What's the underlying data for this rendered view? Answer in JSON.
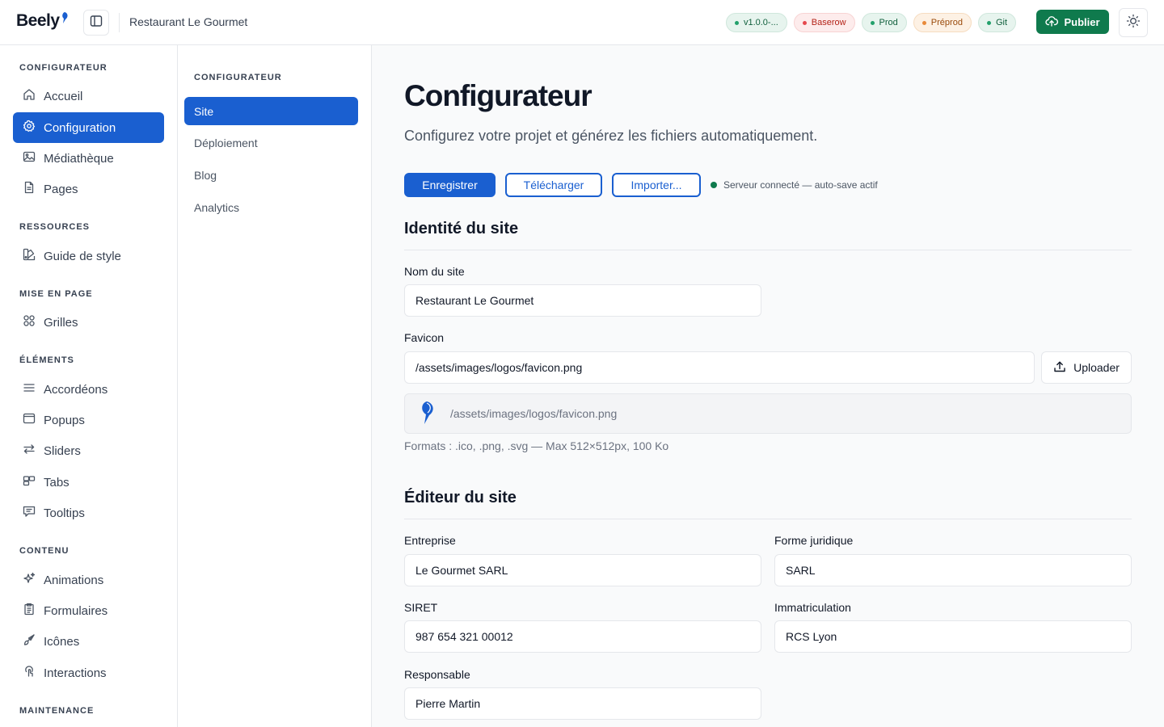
{
  "topbar": {
    "logo_text": "Beely",
    "project_name": "Restaurant Le Gourmet",
    "badges": [
      {
        "label": "v1.0.0-...",
        "bg": "#e7f4ee",
        "border": "#cfe7dc",
        "color": "#0f5f3c",
        "dot": "#22a06b"
      },
      {
        "label": "Baserow",
        "bg": "#fdecec",
        "border": "#f8d3d3",
        "color": "#b42318",
        "dot": "#e5484d"
      },
      {
        "label": "Prod",
        "bg": "#e7f4ee",
        "border": "#cfe7dc",
        "color": "#0f5f3c",
        "dot": "#22a06b"
      },
      {
        "label": "Préprod",
        "bg": "#fdf1e4",
        "border": "#f6dcc0",
        "color": "#9a4a0a",
        "dot": "#e8893a"
      },
      {
        "label": "Git",
        "bg": "#e7f4ee",
        "border": "#cfe7dc",
        "color": "#0f5f3c",
        "dot": "#22a06b"
      }
    ],
    "publish_label": "Publier"
  },
  "sidebar": {
    "sections": [
      {
        "title": "CONFIGURATEUR"
      },
      {
        "title": "RESSOURCES"
      },
      {
        "title": "MISE EN PAGE"
      },
      {
        "title": "ÉLÉMENTS"
      },
      {
        "title": "CONTENU"
      },
      {
        "title": "MAINTENANCE"
      }
    ],
    "items": [
      {
        "label": "Accueil",
        "icon": "home-icon"
      },
      {
        "label": "Configuration",
        "icon": "gear-icon",
        "active": true
      },
      {
        "label": "Médiathèque",
        "icon": "image-icon"
      },
      {
        "label": "Pages",
        "icon": "file-icon"
      },
      {
        "label": "Guide de style",
        "icon": "palette-icon"
      },
      {
        "label": "Grilles",
        "icon": "grid-icon"
      },
      {
        "label": "Accordéons",
        "icon": "list-icon"
      },
      {
        "label": "Popups",
        "icon": "window-icon"
      },
      {
        "label": "Sliders",
        "icon": "arrows-icon"
      },
      {
        "label": "Tabs",
        "icon": "tabs-icon"
      },
      {
        "label": "Tooltips",
        "icon": "message-icon"
      },
      {
        "label": "Animations",
        "icon": "sparkle-icon"
      },
      {
        "label": "Formulaires",
        "icon": "clipboard-icon"
      },
      {
        "label": "Icônes",
        "icon": "brush-icon"
      },
      {
        "label": "Interactions",
        "icon": "pointer-icon"
      }
    ]
  },
  "subnav": {
    "title": "CONFIGURATEUR",
    "items": [
      {
        "label": "Site",
        "active": true
      },
      {
        "label": "Déploiement"
      },
      {
        "label": "Blog"
      },
      {
        "label": "Analytics"
      }
    ]
  },
  "main": {
    "title": "Configurateur",
    "subtitle": "Configurez votre projet et générez les fichiers automatiquement.",
    "actions": {
      "save": "Enregistrer",
      "download": "Télécharger",
      "import": "Importer...",
      "status": "Serveur connecté — auto-save actif"
    },
    "identity": {
      "title": "Identité du site",
      "site_name_label": "Nom du site",
      "site_name_value": "Restaurant Le Gourmet",
      "favicon_label": "Favicon",
      "favicon_value": "/assets/images/logos/favicon.png",
      "upload_label": "Uploader",
      "preview_path": "/assets/images/logos/favicon.png",
      "hint": "Formats : .ico, .png, .svg — Max 512×512px, 100 Ko"
    },
    "publisher": {
      "title": "Éditeur du site",
      "company_label": "Entreprise",
      "company_value": "Le Gourmet SARL",
      "legal_form_label": "Forme juridique",
      "legal_form_value": "SARL",
      "siret_label": "SIRET",
      "siret_value": "987 654 321 00012",
      "registration_label": "Immatriculation",
      "registration_value": "RCS Lyon",
      "manager_label": "Responsable",
      "manager_value": "Pierre Martin"
    }
  },
  "colors": {
    "accent": "#1a5fd0",
    "publish": "#0f7a4d",
    "status_ok": "#0f7a4d"
  }
}
